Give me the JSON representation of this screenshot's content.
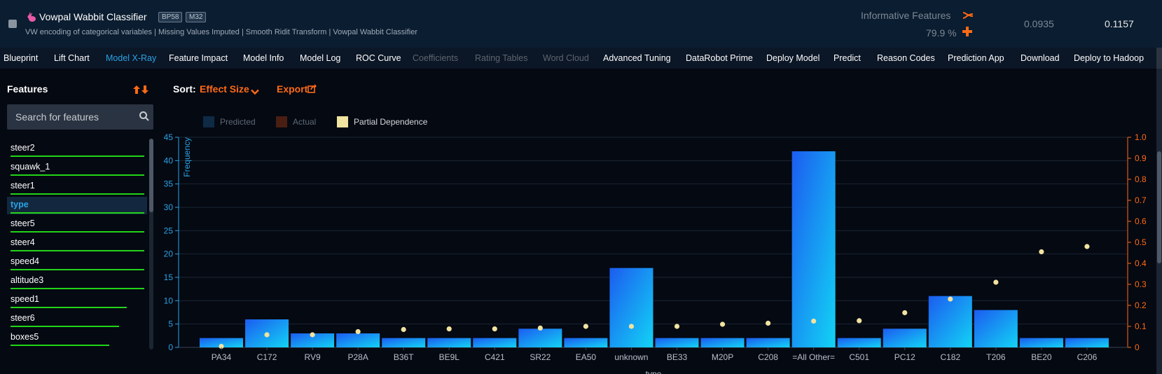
{
  "header": {
    "title": "Vowpal Wabbit Classifier",
    "badges": [
      "BP58",
      "M32"
    ],
    "subtitle": "VW encoding of categorical variables | Missing Values Imputed | Smooth Ridit Transform | Vowpal Wabbit Classifier",
    "informative_label": "Informative Features",
    "informative_pct": "79.9 %",
    "score_validation": "0.0935",
    "score_cv": "0.1157",
    "icons": {
      "logo": "rabbit-icon",
      "informative": "scissors-icon",
      "add": "plus-icon"
    }
  },
  "tabs": [
    {
      "label": "Blueprint",
      "state": "normal"
    },
    {
      "label": "Lift Chart",
      "state": "normal"
    },
    {
      "label": "Model X-Ray",
      "state": "active"
    },
    {
      "label": "Feature Impact",
      "state": "normal"
    },
    {
      "label": "Model Info",
      "state": "normal"
    },
    {
      "label": "Model Log",
      "state": "normal"
    },
    {
      "label": "ROC Curve",
      "state": "normal"
    },
    {
      "label": "Coefficients",
      "state": "disabled"
    },
    {
      "label": "Rating Tables",
      "state": "disabled"
    },
    {
      "label": "Word Cloud",
      "state": "disabled"
    },
    {
      "label": "Advanced Tuning",
      "state": "normal"
    },
    {
      "label": "DataRobot Prime",
      "state": "normal"
    },
    {
      "label": "Deploy Model",
      "state": "normal"
    },
    {
      "label": "Predict",
      "state": "normal"
    },
    {
      "label": "Reason Codes",
      "state": "normal"
    },
    {
      "label": "Prediction App",
      "state": "normal"
    },
    {
      "label": "Download",
      "state": "normal"
    },
    {
      "label": "Deploy to Hadoop",
      "state": "normal"
    }
  ],
  "sidebar": {
    "title": "Features",
    "search_placeholder": "Search for features",
    "features": [
      {
        "label": "steer2",
        "importance": 1.0
      },
      {
        "label": "squawk_1",
        "importance": 1.0
      },
      {
        "label": "steer1",
        "importance": 1.0
      },
      {
        "label": "type",
        "importance": 1.0,
        "selected": true
      },
      {
        "label": "steer5",
        "importance": 1.0
      },
      {
        "label": "steer4",
        "importance": 1.0
      },
      {
        "label": "speed4",
        "importance": 1.0
      },
      {
        "label": "altitude3",
        "importance": 1.0
      },
      {
        "label": "speed1",
        "importance": 0.87
      },
      {
        "label": "steer6",
        "importance": 0.81
      },
      {
        "label": "boxes5",
        "importance": 0.74
      }
    ]
  },
  "controls": {
    "sort_label": "Sort:",
    "sort_value": "Effect Size",
    "export_label": "Export"
  },
  "legend": [
    {
      "label": "Predicted",
      "color": "#0e2a45",
      "text_color": "#5d6876"
    },
    {
      "label": "Actual",
      "color": "#4a1e12",
      "text_color": "#5d6876"
    },
    {
      "label": "Partial Dependence",
      "color": "#f1e3a0",
      "text_color": "#d4d8dc"
    }
  ],
  "colors": {
    "accent_blue": "#2aa3e6",
    "accent_orange": "#ff6a16",
    "bar_gradient_start": "#1c5cf0",
    "bar_gradient_end": "#12d3f5",
    "pd_dot": "#f1e3a0"
  },
  "chart_data": {
    "type": "bar",
    "xlabel": "type",
    "ylabel": "Frequency",
    "ylim": [
      0,
      45
    ],
    "y_ticks": [
      0,
      5,
      10,
      15,
      20,
      25,
      30,
      35,
      40,
      45
    ],
    "y2lim": [
      0,
      1.0
    ],
    "y2_ticks": [
      "0",
      "0.1",
      "0.2",
      "0.3",
      "0.4",
      "0.5",
      "0.6",
      "0.7",
      "0.8",
      "0.9",
      "1.0"
    ],
    "categories": [
      "PA34",
      "C172",
      "RV9",
      "P28A",
      "B36T",
      "BE9L",
      "C421",
      "SR22",
      "EA50",
      "unknown",
      "BE33",
      "M20P",
      "C208",
      "=All Other=",
      "C501",
      "PC12",
      "C182",
      "T206",
      "BE20",
      "C206"
    ],
    "series": [
      {
        "name": "Frequency",
        "values": [
          2,
          6,
          3,
          3,
          2,
          2,
          2,
          4,
          2,
          17,
          2,
          2,
          2,
          42,
          2,
          4,
          11,
          8,
          2,
          2
        ]
      },
      {
        "name": "Partial Dependence",
        "values": [
          0.005,
          0.06,
          0.06,
          0.075,
          0.085,
          0.088,
          0.088,
          0.092,
          0.1,
          0.1,
          0.1,
          0.11,
          0.115,
          0.125,
          0.127,
          0.165,
          0.23,
          0.31,
          0.455,
          0.48
        ]
      }
    ],
    "grid": true
  }
}
